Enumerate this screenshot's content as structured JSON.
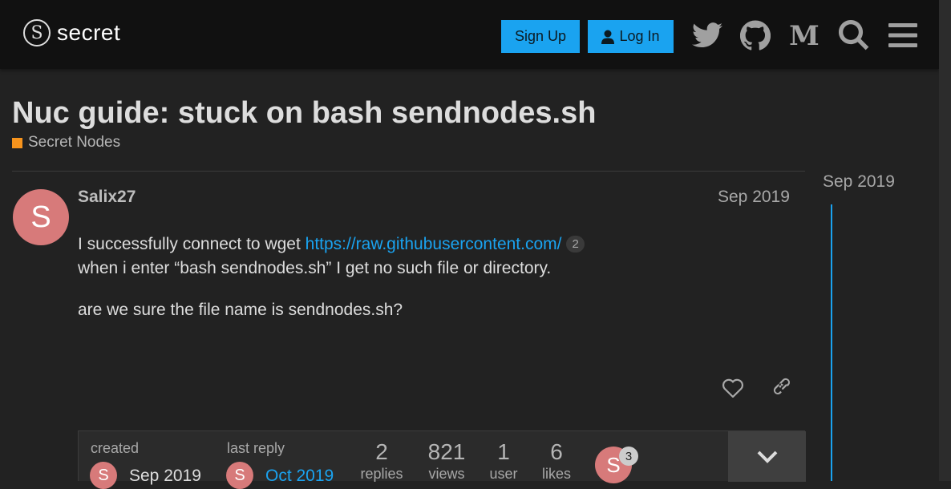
{
  "header": {
    "logo_glyph": "S",
    "logo_text": "secret",
    "signup_label": "Sign Up",
    "login_label": "Log In",
    "icons": [
      "twitter-icon",
      "github-icon",
      "medium-icon",
      "search-icon",
      "hamburger-menu-icon"
    ]
  },
  "topic": {
    "title": "Nuc guide: stuck on bash sendnodes.sh",
    "category": "Secret Nodes",
    "category_color": "#f7941d"
  },
  "post": {
    "avatar_letter": "S",
    "username": "Salix27",
    "date": "Sep 2019",
    "line1_prefix": "I successfully connect to wget ",
    "link_text": "https://raw.githubusercontent.com/",
    "link_clicks": "2",
    "line2": "when i enter “bash sendnodes.sh” I get no such file or directory.",
    "line3": "are we sure the file name is sendnodes.sh?"
  },
  "topic_map": {
    "created_label": "created",
    "created_avatar": "S",
    "created_date": "Sep 2019",
    "last_reply_label": "last reply",
    "last_reply_avatar": "S",
    "last_reply_date": "Oct 2019",
    "stats": [
      {
        "num": "2",
        "label": "replies"
      },
      {
        "num": "821",
        "label": "views"
      },
      {
        "num": "1",
        "label": "user"
      },
      {
        "num": "6",
        "label": "likes"
      }
    ],
    "participant_avatar": "S",
    "participant_count": "3"
  },
  "timeline": {
    "date": "Sep 2019"
  },
  "colors": {
    "accent": "#1aa3f0",
    "avatar": "#d77a7a",
    "background": "#222222",
    "header": "#111111"
  }
}
